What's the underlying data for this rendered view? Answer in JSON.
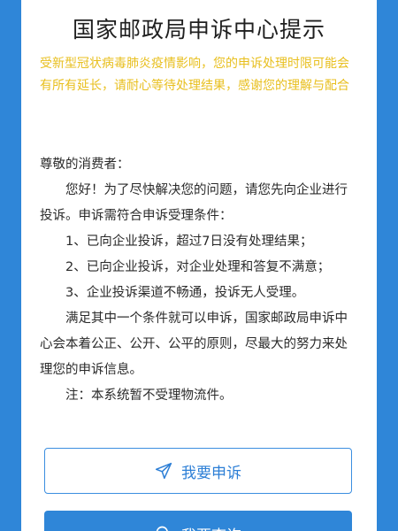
{
  "title": "国家邮政局申诉中心提示",
  "notice": "受新型冠状病毒肺炎疫情影响，您的申诉处理时限可能会有所有延长，请耐心等待处理结果，感谢您的理解与配合",
  "greeting": "尊敬的消费者：",
  "intro": "您好！为了尽快解决您的问题，请您先向企业进行投诉。申诉需符合申诉受理条件：",
  "conditions": [
    "1、已向企业投诉，超过7日没有处理结果；",
    "2、已向企业投诉，对企业处理和答复不满意；",
    "3、企业投诉渠道不畅通，投诉无人受理。"
  ],
  "summary": "满足其中一个条件就可以申诉，国家邮政局申诉中心会本着公正、公开、公平的原则，尽最大的努力来处理您的申诉信息。",
  "note": "注：本系统暂不受理物流件。",
  "buttons": {
    "complain_label": "我要申诉",
    "second_label": "我要查询"
  },
  "colors": {
    "accent": "#2f86d8",
    "notice": "#e8bf1e",
    "text": "#2a2a2a"
  },
  "icons": {
    "complain": "send-icon",
    "second": "search-icon"
  }
}
